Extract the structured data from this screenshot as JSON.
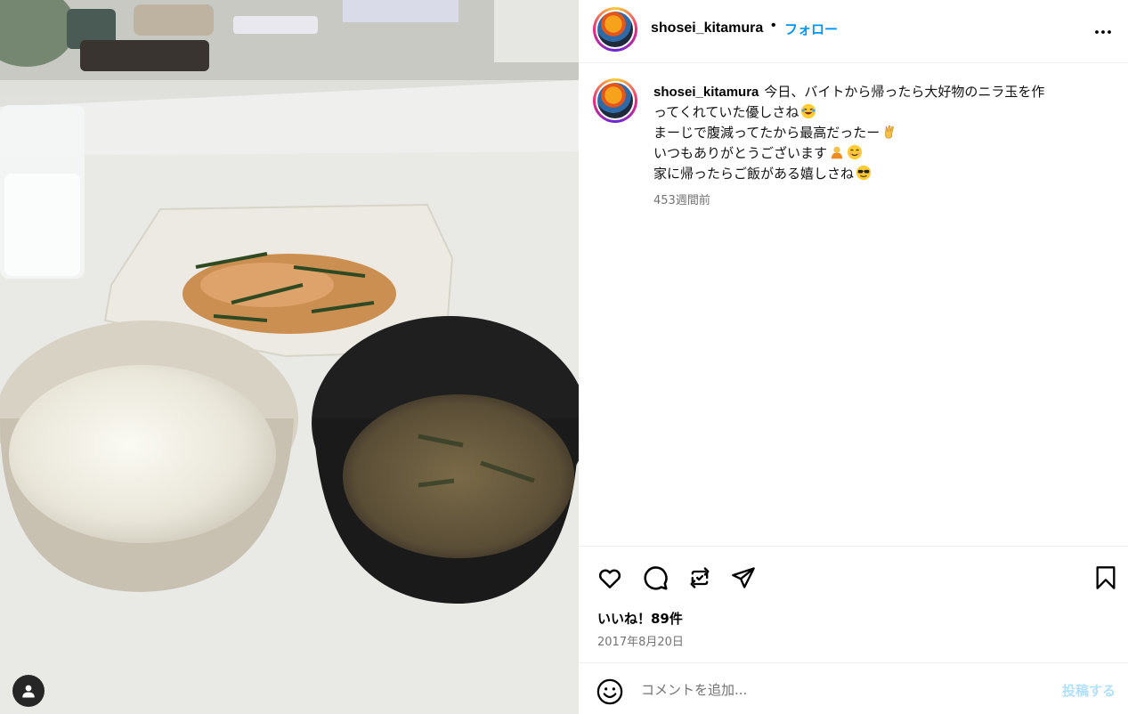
{
  "post": {
    "image_alt": "ニラ玉、ご飯、味噌汁の写真",
    "user_tag_icon": "person-icon"
  },
  "header": {
    "username": "shosei_kitamura",
    "separator": "•",
    "follow_label": "フォロー",
    "more_icon": "more-horizontal-icon"
  },
  "caption": {
    "username": "shosei_kitamura",
    "lines": [
      "今日、バイトから帰ったら大好物のニラ玉を作",
      "ってくれていた優しさね",
      "まーじで腹減ってたから最高だったー",
      "いつもありがとうございます",
      "家に帰ったらご飯がある嬉しさね"
    ],
    "emojis": [
      "laughing-face-emoji",
      "victory-hand-emoji",
      "bowing-person-emoji",
      "smiling-face-emoji",
      "sunglasses-face-emoji"
    ],
    "time_ago": "453週間前"
  },
  "actions": {
    "like_icon": "heart-icon",
    "comment_icon": "comment-icon",
    "repost_icon": "repost-icon",
    "share_icon": "share-icon",
    "save_icon": "bookmark-icon"
  },
  "likes_text": "いいね！89件",
  "date_text": "2017年8月20日",
  "comment": {
    "emoji_icon": "emoji-smile-icon",
    "placeholder": "コメントを追加...",
    "post_label": "投稿する"
  },
  "colors": {
    "accent": "#0095f6",
    "post_disabled": "#b2dffc",
    "muted": "#737373"
  }
}
